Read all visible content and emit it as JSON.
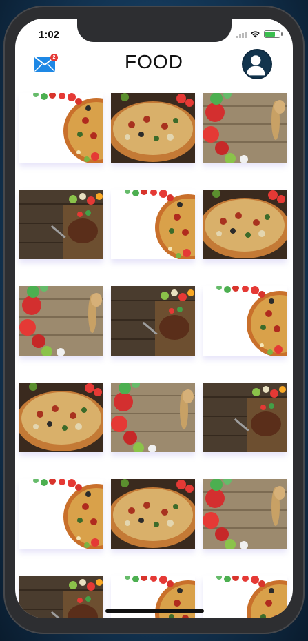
{
  "status_bar": {
    "time": "1:02"
  },
  "nav": {
    "title": "FOOD",
    "mail_badge": "2"
  },
  "colors": {
    "mail_icon": "#1e88e5",
    "badge": "#e53935",
    "avatar_bg": "#12344d"
  },
  "grid": {
    "columns": 3,
    "tiles": [
      "pizza-corner",
      "pizza-full",
      "vegetables-board",
      "grill-board",
      "pizza-corner",
      "pizza-full",
      "vegetables-board",
      "grill-board",
      "pizza-corner",
      "pizza-full",
      "vegetables-board",
      "grill-board",
      "pizza-corner",
      "pizza-full",
      "vegetables-board",
      "grill-board",
      "pizza-corner",
      "pizza-corner"
    ]
  }
}
